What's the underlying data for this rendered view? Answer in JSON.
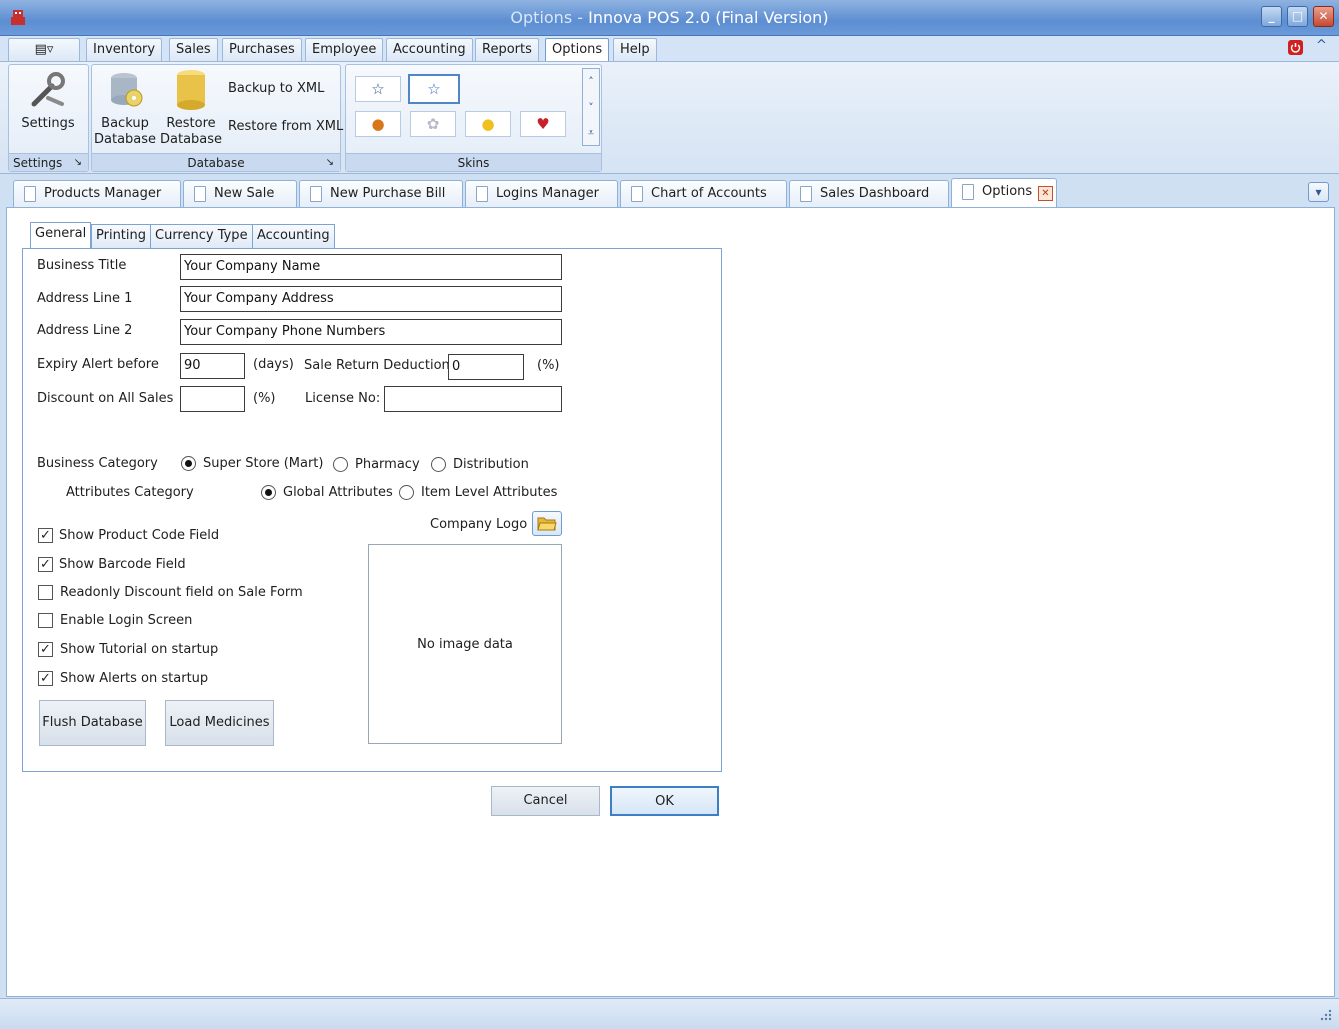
{
  "window": {
    "title_prefix": "Options",
    "title_sep": " - ",
    "title_main": "Innova POS 2.0  (Final Version)",
    "min_glyph": "_",
    "max_glyph": "□",
    "close_glyph": "✕"
  },
  "menu": {
    "quick_access_glyph": "▤▿",
    "tabs": [
      "Inventory",
      "Sales",
      "Purchases",
      "Employee",
      "Accounting",
      "Reports",
      "Options",
      "Help"
    ],
    "active_tab": "Options",
    "collapse_glyph": "^"
  },
  "ribbon": {
    "settings_group": {
      "label": "Settings",
      "button_label": "Settings",
      "expander": "↘"
    },
    "database_group": {
      "label": "Database",
      "backup_label_1": "Backup",
      "backup_label_2": "Database",
      "restore_label_1": "Restore",
      "restore_label_2": "Database",
      "backup_xml": "Backup to XML",
      "restore_xml": "Restore from XML",
      "expander": "↘"
    },
    "skins_group": {
      "label": "Skins",
      "skins": [
        "☆",
        "☆",
        "●",
        "✿",
        "●",
        "♥"
      ],
      "scroll_up": "˄",
      "scroll_down": "˅",
      "scroll_more": "⩡"
    }
  },
  "document_tabs": {
    "tabs": [
      "Products Manager",
      "New Sale",
      "New Purchase Bill",
      "Logins Manager",
      "Chart of Accounts",
      "Sales Dashboard",
      "Options"
    ],
    "active": "Options",
    "close_glyph": "✕",
    "menu_glyph": "▾"
  },
  "options_form": {
    "subtabs": [
      "General",
      "Printing",
      "Currency Type",
      "Accounting"
    ],
    "active_subtab": "General",
    "business_title_label": "Business Title",
    "business_title_value": "Your Company Name",
    "address1_label": "Address Line 1",
    "address1_value": "Your Company Address",
    "address2_label": "Address Line 2",
    "address2_value": "Your Company Phone Numbers",
    "expiry_label": "Expiry Alert before",
    "expiry_value": "90",
    "expiry_unit": "(days)",
    "sale_return_label": "Sale Return Deduction",
    "sale_return_value": "0",
    "sale_return_unit": "(%)",
    "discount_label": "Discount on All Sales",
    "discount_value": "",
    "discount_unit": "(%)",
    "license_label": "License No:",
    "license_value": "",
    "business_category_label": "Business Category",
    "business_categories": [
      "Super Store (Mart)",
      "Pharmacy",
      "Distribution"
    ],
    "business_category_selected": "Super Store (Mart)",
    "attributes_category_label": "Attributes Category",
    "attributes_categories": [
      "Global Attributes",
      "Item Level Attributes"
    ],
    "attributes_category_selected": "Global Attributes",
    "checkboxes": [
      {
        "label": "Show Product Code Field",
        "checked": true
      },
      {
        "label": "Show Barcode Field",
        "checked": true
      },
      {
        "label": "Readonly Discount field on Sale Form",
        "checked": false
      },
      {
        "label": "Enable Login Screen",
        "checked": false
      },
      {
        "label": "Show Tutorial on startup",
        "checked": true
      },
      {
        "label": "Show Alerts on startup",
        "checked": true
      }
    ],
    "check_glyph": "✓",
    "company_logo_label": "Company Logo",
    "no_image_text": "No image data",
    "flush_button": "Flush Database",
    "load_medicines_button": "Load Medicines",
    "cancel_button": "Cancel",
    "ok_button": "OK"
  },
  "colors": {
    "title_bar": "#5d8ed2",
    "accent_border": "#4f86c6",
    "close_button": "#c84830"
  }
}
